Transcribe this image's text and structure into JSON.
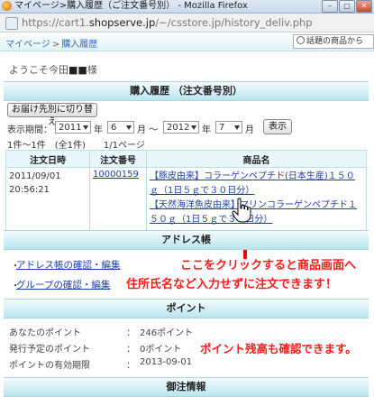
{
  "window": {
    "title": "マイページ>購入履歴（ご注文番号別） - Mozilla Firefox",
    "url_prefix": "https://cart1.",
    "url_domain": "shopserve.jp",
    "url_suffix": "/~/csstore.jp/history_deliv.php",
    "buttons": [
      "–",
      "▢",
      "✕"
    ]
  },
  "breadcrumb": {
    "items": [
      "マイページ",
      "購入履歴"
    ],
    "sep": ">"
  },
  "search": {
    "text": "話題の商品から"
  },
  "welcome": {
    "prefix": "ようこそ今田",
    "name": "■■",
    "suffix": "様"
  },
  "history": {
    "title": "購入履歴 （注文番号別）",
    "switch_button": "お届け先別に切り替え",
    "period_label": "表示期間：",
    "from_year": "2011",
    "from_year_unit": "年",
    "from_month": "6",
    "from_month_unit": "月 ～",
    "to_year": "2012",
    "to_year_unit": "年",
    "to_month": "7",
    "to_month_unit": "月",
    "show_button": "表示",
    "count_text": "1件～1件　(全1件)　　1/1ページ",
    "headers": [
      "注文日時",
      "注文番号",
      "商品名"
    ],
    "row": {
      "date": "2011/09/01",
      "time": "20:56:21",
      "order_no": "10000159",
      "item1": "【豚皮由来】コラーゲンペプチド(日本生産)１５０ｇ（1日５ｇで３０日分）",
      "item2": "【天然海洋魚皮由来】マリンコラーゲンペプチド１５０ｇ（1日５ｇで３０日分）"
    }
  },
  "address": {
    "title": "アドレス帳",
    "links": [
      "アドレス帳の確認・編集",
      "グループの確認・編集"
    ],
    "bullet": "・"
  },
  "points": {
    "title": "ポイント",
    "rows": [
      {
        "label": "あなたのポイント",
        "value": "246ポイント"
      },
      {
        "label": "発行予定のポイント",
        "value": "0ポイント"
      },
      {
        "label": "ポイントの有効期限",
        "value": "2013-09-01"
      }
    ],
    "colon": "："
  },
  "annotations": {
    "line1": "ここをクリックすると商品画面へ",
    "line2": "住所氏名など入力せずに注文できます！",
    "line3": "ポイント残高も確認できます。"
  },
  "next_section": {
    "title": "御注情報"
  },
  "colors": {
    "annotation": "#ff1a1a",
    "link": "#1a3fb0",
    "section_bar": "#b8e5ef"
  }
}
